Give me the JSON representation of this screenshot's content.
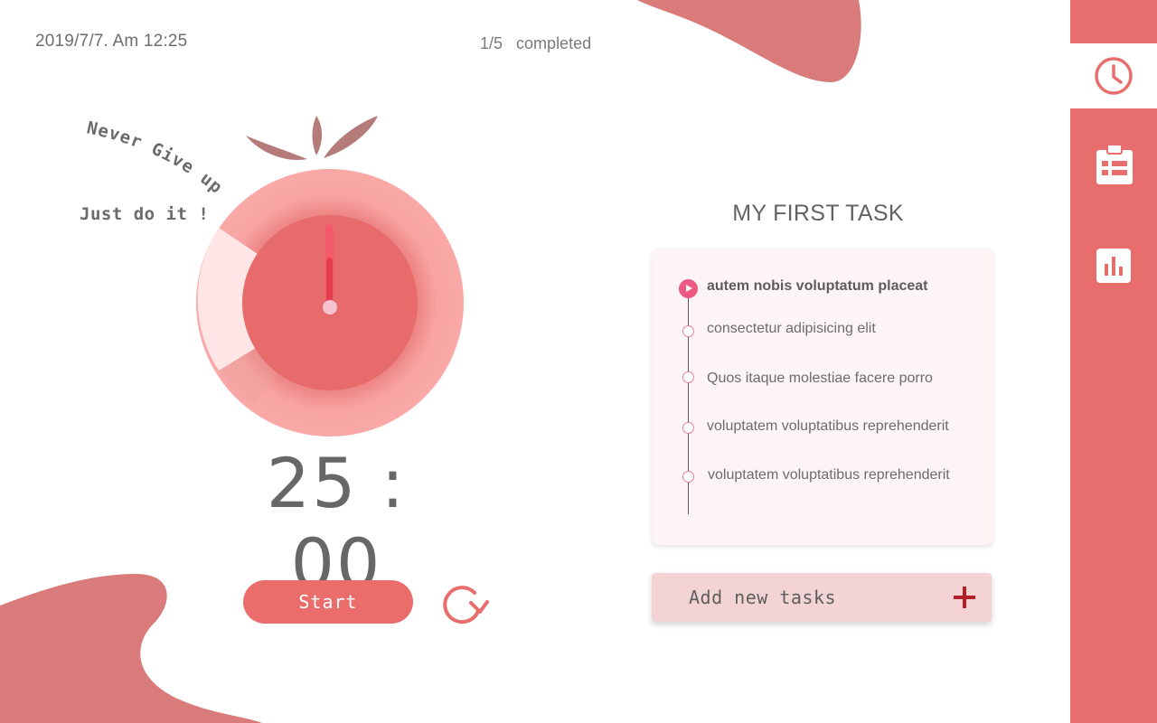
{
  "header": {
    "datetime": "2019/7/7.  Am 12:25",
    "progress_count": "1/5",
    "progress_label": "completed"
  },
  "motto": {
    "line1": "Never Give up",
    "line2": "Just do it !"
  },
  "timer": {
    "display": "25 : 00",
    "elapsed_fraction": 0.2
  },
  "controls": {
    "start_label": "Start"
  },
  "tasks": {
    "title": "MY  FIRST TASK",
    "items": [
      {
        "label": "autem nobis voluptatum placeat",
        "active": true
      },
      {
        "label": "consectetur adipisicing elit",
        "active": false
      },
      {
        "label": "Quos itaque molestiae facere porro",
        "active": false
      },
      {
        "label": "voluptatem voluptatibus reprehenderit",
        "active": false
      },
      {
        "label": "voluptatem voluptatibus reprehenderit",
        "active": false
      }
    ],
    "add_label": "Add new tasks"
  },
  "sidebar": {
    "items": [
      {
        "icon": "clock-icon",
        "active": true
      },
      {
        "icon": "task-list-icon",
        "active": false
      },
      {
        "icon": "bar-chart-icon",
        "active": false
      }
    ]
  },
  "colors": {
    "accent": "#e86e6d",
    "blob": "#d97b7b",
    "tomato_outer": "#f8a19f",
    "tomato_inner": "#e86b6b",
    "leaf": "#b57a7a",
    "active_dot": "#ec5a83",
    "add_plus": "#b51f25"
  }
}
